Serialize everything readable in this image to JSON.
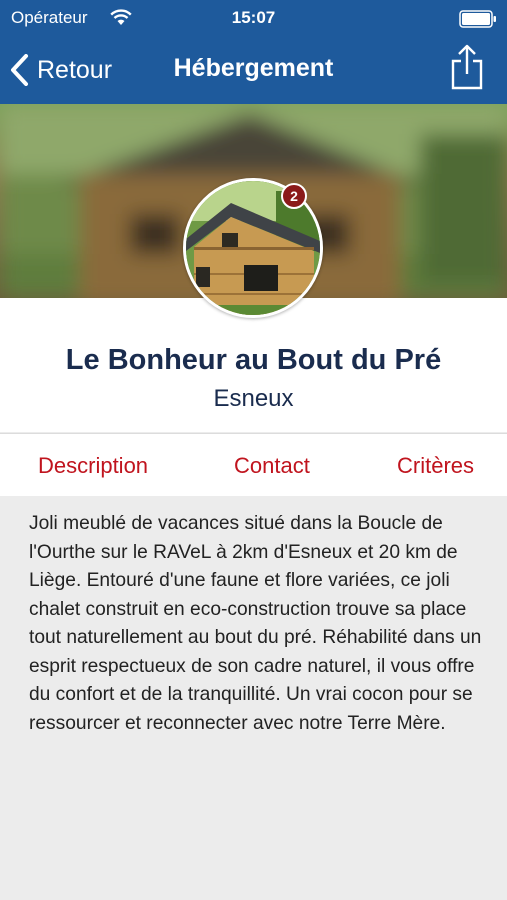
{
  "status_bar": {
    "carrier": "Opérateur",
    "time": "15:07"
  },
  "nav_bar": {
    "back_label": "Retour",
    "title": "Hébergement"
  },
  "listing": {
    "title": "Le Bonheur au Bout du Pré",
    "city": "Esneux",
    "badge_count": "2"
  },
  "tabs": [
    {
      "label": "Description"
    },
    {
      "label": "Contact"
    },
    {
      "label": "Critères"
    }
  ],
  "description": "Joli meublé de vacances situé dans la Boucle de l'Ourthe sur le RAVeL à 2km d'Esneux et 20 km de Liège. Entouré d'une faune et flore variées, ce joli chalet construit en eco-construction trouve sa place tout naturellement au bout du pré. Réhabilité dans un esprit respectueux de son cadre naturel, il vous offre du confort et de la tranquillité. Un vrai cocon pour se ressourcer et reconnecter avec notre Terre Mère.",
  "colors": {
    "nav_background": "#1e5a9c",
    "accent": "#c0141e",
    "title_text": "#1a2c4e",
    "badge": "#8b1a1a"
  },
  "icons": {
    "back": "chevron-left-icon",
    "share": "share-icon",
    "wifi": "wifi-icon",
    "battery": "battery-icon"
  }
}
